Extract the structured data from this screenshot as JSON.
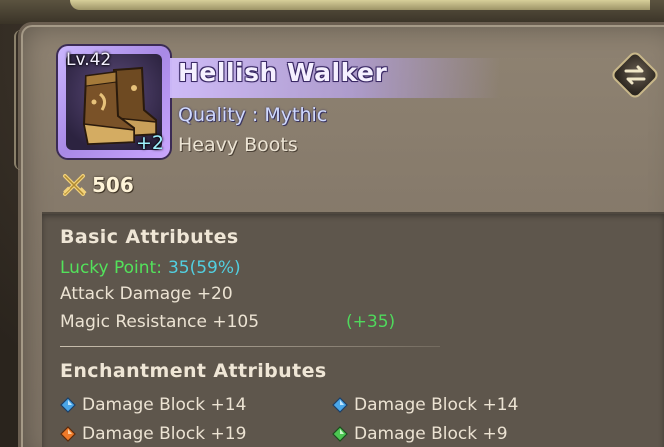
{
  "item": {
    "level": "Lv.42",
    "enhance": "+2",
    "name": "Hellish Walker",
    "quality": "Quality : Mythic",
    "type": "Heavy Boots",
    "power": "506",
    "icon": "heavy-boots-icon"
  },
  "basic_attributes": {
    "title": "Basic Attributes",
    "lucky_label": "Lucky Point:",
    "lucky_value": "35(59%)",
    "attack_damage": "Attack Damage +20",
    "magic_resistance": "Magic Resistance +105",
    "magic_resistance_bonus": "(+35)"
  },
  "enchantment_attributes": {
    "title": "Enchantment Attributes",
    "items": [
      {
        "text": "Damage Block +14",
        "gem": "blue-gem-icon"
      },
      {
        "text": "Damage Block +14",
        "gem": "blue-gem-icon"
      },
      {
        "text": "Damage Block +19",
        "gem": "orange-gem-icon"
      },
      {
        "text": "Damage Block +9",
        "gem": "green-gem-icon"
      }
    ]
  },
  "colors": {
    "mythic": "#cbb7ff",
    "lucky_label": "#53e25b",
    "lucky_value": "#52cfe0",
    "bonus": "#4fd95c"
  },
  "buttons": {
    "swap_icon": "swap-arrows-icon"
  }
}
